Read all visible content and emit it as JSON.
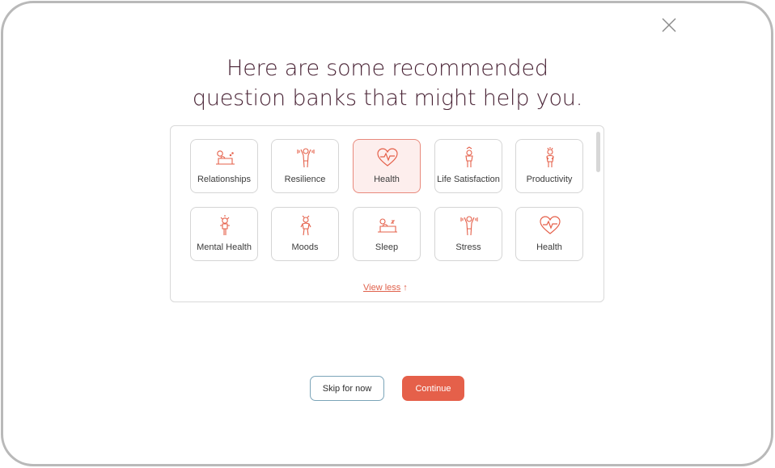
{
  "dialog": {
    "heading_line1": "Here are some recommended",
    "heading_line2": "question banks that might help you."
  },
  "colors": {
    "accent": "#e5604a",
    "heading": "#4a2436",
    "selected_bg": "#fdeeed"
  },
  "question_banks": [
    {
      "label": "Relationships",
      "icon": "couple-bed-icon",
      "selected": false
    },
    {
      "label": "Resilience",
      "icon": "person-arms-up-icon",
      "selected": false
    },
    {
      "label": "Health",
      "icon": "heart-pulse-icon",
      "selected": true
    },
    {
      "label": "Life Satisfaction",
      "icon": "person-star-icon",
      "selected": false
    },
    {
      "label": "Productivity",
      "icon": "person-stressed-icon",
      "selected": false
    },
    {
      "label": "Mental Health",
      "icon": "person-head-icon",
      "selected": false
    },
    {
      "label": "Moods",
      "icon": "person-mood-icon",
      "selected": false
    },
    {
      "label": "Sleep",
      "icon": "bed-sleep-icon",
      "selected": false
    },
    {
      "label": "Stress",
      "icon": "person-shake-icon",
      "selected": false
    },
    {
      "label": "Health",
      "icon": "heart-pulse-icon",
      "selected": false
    }
  ],
  "view_toggle": {
    "label": "View less",
    "arrow": "↑"
  },
  "actions": {
    "skip_label": "Skip for now",
    "continue_label": "Continue"
  }
}
